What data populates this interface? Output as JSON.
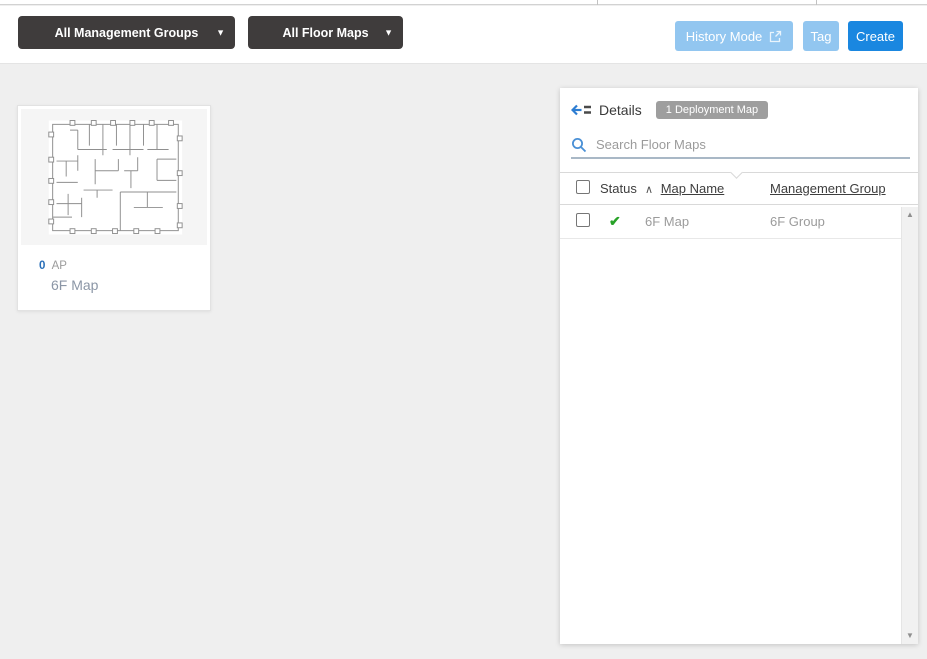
{
  "toolbar": {
    "management_groups_dropdown": {
      "label": "All Management Groups"
    },
    "floor_maps_dropdown": {
      "label": "All Floor Maps"
    },
    "history_mode_button": {
      "label": "History Mode"
    },
    "tag_button": {
      "label": "Tag"
    },
    "create_button": {
      "label": "Create"
    }
  },
  "floor_map_card": {
    "ap_count": "0",
    "ap_label": "AP",
    "name": "6F Map"
  },
  "details_panel": {
    "title": "Details",
    "deployment_badge": "1 Deployment Map",
    "search": {
      "placeholder": "Search Floor Maps",
      "value": ""
    },
    "table": {
      "columns": [
        "Status",
        "Map Name",
        "Management Group"
      ],
      "rows": [
        {
          "status": "ok",
          "map_name": "6F Map",
          "management_group": "6F Group"
        }
      ]
    }
  },
  "glyphs": {
    "dropdown_arrow": "▼",
    "sort_ascending": "∧",
    "check": "✔",
    "scroll_up": "▲",
    "scroll_down": "▼"
  },
  "colors": {
    "accent_blue": "#1a87e0",
    "disabled_blue": "#92c6f0",
    "dropdown_dark": "#3f3c3c",
    "badge_gray": "#9e9e9e",
    "success_green": "#28a228",
    "icon_blue": "#2d7dd2"
  }
}
